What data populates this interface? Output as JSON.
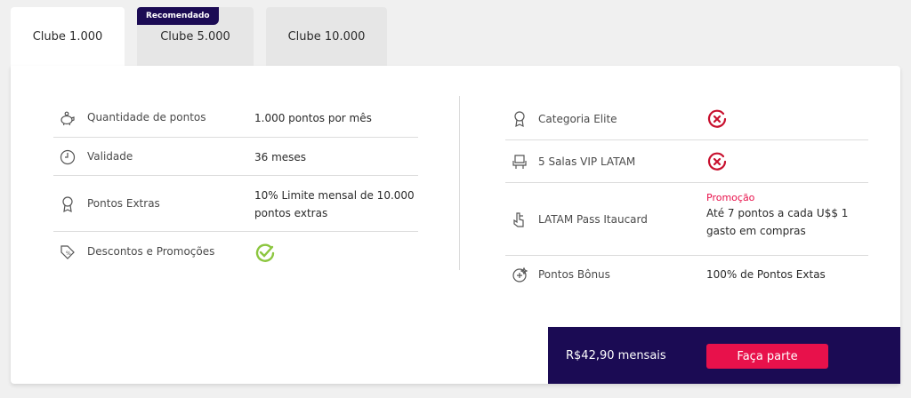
{
  "tabs": [
    {
      "label": "Clube 1.000",
      "active": true
    },
    {
      "label": "Clube 5.000",
      "active": false
    },
    {
      "label": "Clube 10.000",
      "active": false
    }
  ],
  "badge": "Recomendado",
  "left_benefits": [
    {
      "label": "Quantidade de pontos",
      "value": "1.000 pontos por mês",
      "icon": "piggy-bank-icon"
    },
    {
      "label": "Validade",
      "value": "36 meses",
      "icon": "clock-icon"
    },
    {
      "label": "Pontos Extras",
      "value": "10% Limite mensal de 10.000 pontos extras",
      "icon": "badge-icon"
    },
    {
      "label": "Descontos e Promoções",
      "value_status": "included",
      "icon": "discount-tag-icon"
    }
  ],
  "right_benefits": [
    {
      "label": "Categoria Elite",
      "value_status": "not-included",
      "icon": "badge-icon"
    },
    {
      "label": "5 Salas VIP LATAM",
      "value_status": "not-included",
      "icon": "armchair-icon"
    },
    {
      "label": "LATAM Pass Itaucard",
      "promo": "Promoção",
      "value": "Até 7 pontos a cada U$$ 1 gasto em compras",
      "icon": "card-hand-icon"
    },
    {
      "label": "Pontos Bônus",
      "value": "100% de Pontos Extas",
      "icon": "bonus-icon"
    }
  ],
  "footer": {
    "price": "R$42,90 mensais",
    "cta": "Faça parte"
  },
  "colors": {
    "brand_dark": "#1b0b54",
    "accent": "#e8114b",
    "check": "#8cc63f",
    "cross": "#c8102e"
  }
}
